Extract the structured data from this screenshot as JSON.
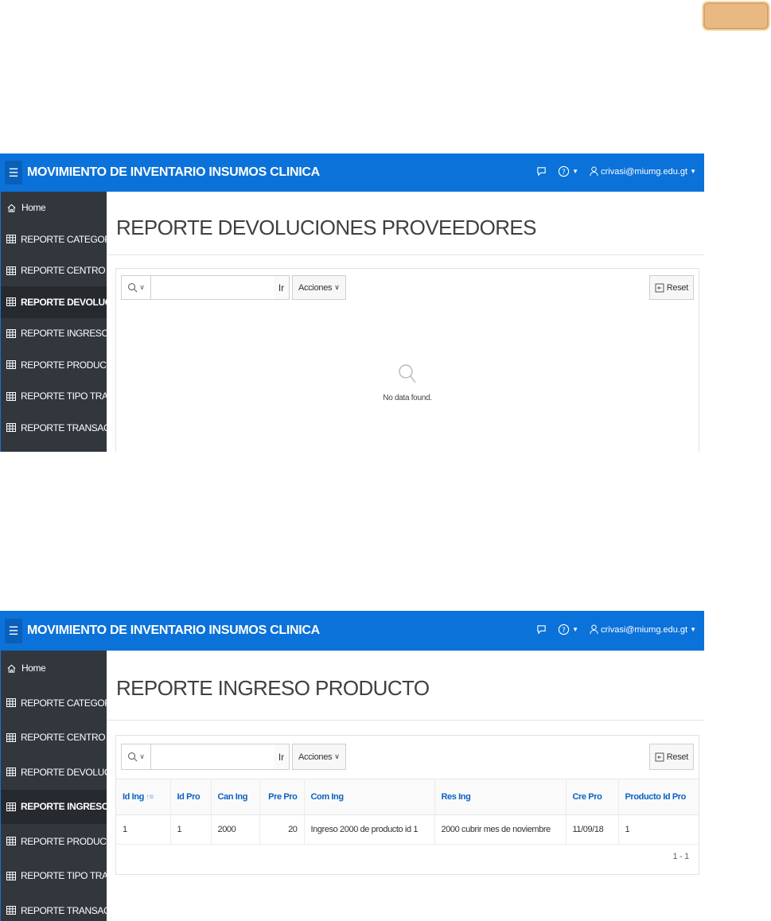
{
  "app": {
    "title": "MOVIMIENTO DE INVENTARIO INSUMOS CLINICA",
    "user": "crivasi@miumg.edu.gt"
  },
  "colors": {
    "header": "#0b72d9",
    "sidebar": "#32373d",
    "active_item": "#26292d",
    "link": "#0b61c0",
    "corner_tab": "#e8b982"
  },
  "nav": {
    "items": [
      {
        "label": "Home",
        "icon": "home-icon"
      },
      {
        "label": "REPORTE CATEGORIA",
        "icon": "table-icon"
      },
      {
        "label": "REPORTE CENTRO",
        "icon": "table-icon"
      },
      {
        "label": "REPORTE DEVOLUCIO...",
        "icon": "table-icon"
      },
      {
        "label": "REPORTE INGRESO PR...",
        "icon": "table-icon"
      },
      {
        "label": "REPORTE PRODUCTO",
        "icon": "table-icon"
      },
      {
        "label": "REPORTE TIPO TRANSA...",
        "icon": "table-icon"
      },
      {
        "label": "REPORTE TRANSACCIO...",
        "icon": "table-icon"
      }
    ],
    "items_alt": [
      {
        "label": "Home"
      },
      {
        "label": "REPORTE CATEGORIA"
      },
      {
        "label": "REPORTE CENTRO"
      },
      {
        "label": "REPORTE DEVOLUCION..."
      },
      {
        "label": "REPORTE INGRESO PR..."
      },
      {
        "label": "REPORTE PRODUCTO"
      },
      {
        "label": "REPORTE TIPO TRANSA..."
      },
      {
        "label": "REPORTE TRANSACCIO..."
      }
    ]
  },
  "toolbar": {
    "search_value": "",
    "go_label": "Ir",
    "actions_label": "Acciones",
    "reset_label": "Reset"
  },
  "page1": {
    "title": "REPORTE DEVOLUCIONES PROVEEDORES",
    "active_index": 3,
    "no_data": "No data found."
  },
  "page2": {
    "title": "REPORTE INGRESO PRODUCTO",
    "active_index": 4,
    "columns": [
      "Id Ing",
      "Id Pro",
      "Can Ing",
      "Pre Pro",
      "Com Ing",
      "Res Ing",
      "Cre Pro",
      "Producto Id Pro"
    ],
    "rows": [
      [
        "1",
        "1",
        "2000",
        "20",
        "Ingreso 2000 de producto id 1",
        "2000 cubrir mes de noviembre",
        "11/09/18",
        "1"
      ]
    ],
    "pagination": "1 - 1"
  }
}
